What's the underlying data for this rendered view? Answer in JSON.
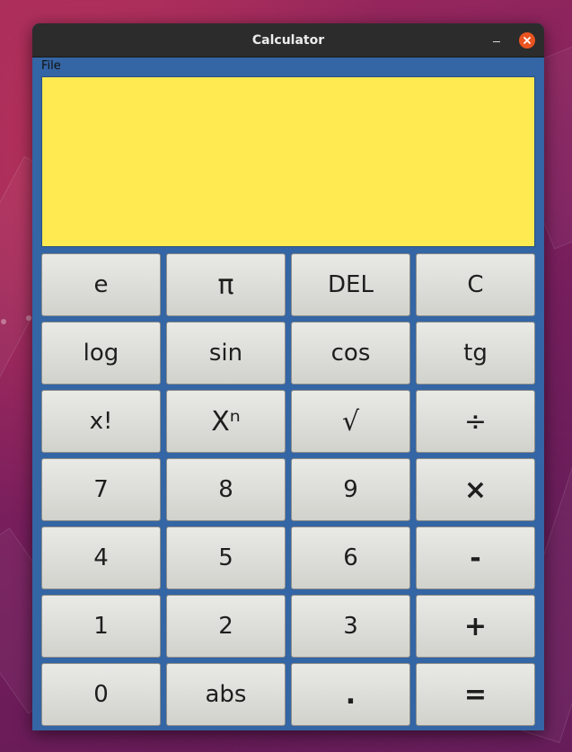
{
  "window": {
    "title": "Calculator"
  },
  "menu": {
    "items": [
      "File"
    ]
  },
  "display": {
    "value": ""
  },
  "keypad": {
    "rows": [
      [
        {
          "label": "e",
          "name": "e-button"
        },
        {
          "label": "π",
          "name": "pi-button"
        },
        {
          "label": "DEL",
          "name": "delete-button"
        },
        {
          "label": "C",
          "name": "clear-button"
        }
      ],
      [
        {
          "label": "log",
          "name": "log-button"
        },
        {
          "label": "sin",
          "name": "sin-button"
        },
        {
          "label": "cos",
          "name": "cos-button"
        },
        {
          "label": "tg",
          "name": "tg-button"
        }
      ],
      [
        {
          "label": "x!",
          "name": "factorial-button"
        },
        {
          "label": "Xⁿ",
          "name": "power-button"
        },
        {
          "label": "√",
          "name": "sqrt-button"
        },
        {
          "label": "÷",
          "name": "divide-button"
        }
      ],
      [
        {
          "label": "7",
          "name": "digit-7-button"
        },
        {
          "label": "8",
          "name": "digit-8-button"
        },
        {
          "label": "9",
          "name": "digit-9-button"
        },
        {
          "label": "×",
          "name": "multiply-button"
        }
      ],
      [
        {
          "label": "4",
          "name": "digit-4-button"
        },
        {
          "label": "5",
          "name": "digit-5-button"
        },
        {
          "label": "6",
          "name": "digit-6-button"
        },
        {
          "label": "-",
          "name": "subtract-button"
        }
      ],
      [
        {
          "label": "1",
          "name": "digit-1-button"
        },
        {
          "label": "2",
          "name": "digit-2-button"
        },
        {
          "label": "3",
          "name": "digit-3-button"
        },
        {
          "label": "+",
          "name": "add-button"
        }
      ],
      [
        {
          "label": "0",
          "name": "digit-0-button"
        },
        {
          "label": "abs",
          "name": "abs-button"
        },
        {
          "label": ".",
          "name": "decimal-point-button"
        },
        {
          "label": "=",
          "name": "equals-button"
        }
      ]
    ]
  },
  "colors": {
    "window_bg": "#3465a4",
    "display_bg": "#ffea52",
    "titlebar_bg": "#2c2c2c",
    "close_button": "#e95420"
  },
  "icons": {
    "minimize": "minimize-icon",
    "close": "close-icon"
  }
}
